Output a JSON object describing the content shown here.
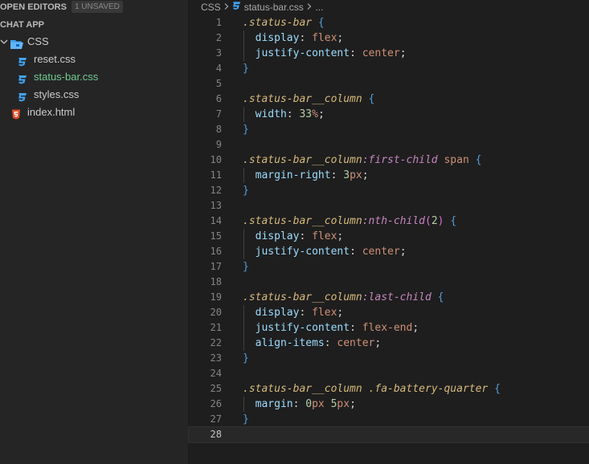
{
  "sidebar": {
    "open_editors": {
      "title": "OPEN EDITORS",
      "badge": "1 UNSAVED"
    },
    "project": {
      "title": "CHAT APP"
    },
    "tree": [
      {
        "label": "CSS",
        "type": "folder",
        "expanded": true,
        "icon": "folder-open-icon"
      },
      {
        "label": "reset.css",
        "type": "css",
        "icon": "css3-icon"
      },
      {
        "label": "status-bar.css",
        "type": "css",
        "icon": "css3-icon",
        "active": true
      },
      {
        "label": "styles.css",
        "type": "css",
        "icon": "css3-icon"
      },
      {
        "label": "index.html",
        "type": "html",
        "icon": "html5-icon"
      }
    ]
  },
  "breadcrumb": {
    "folder": "CSS",
    "file": "status-bar.css",
    "more": "..."
  },
  "editor": {
    "current_line": 28,
    "lines": [
      [
        [
          ".status-bar",
          "sel"
        ],
        [
          " ",
          ""
        ],
        [
          "{",
          "brace"
        ]
      ],
      [
        [
          "  display",
          "prop"
        ],
        [
          ": ",
          "punc"
        ],
        [
          "flex",
          "val"
        ],
        [
          ";",
          "punc"
        ]
      ],
      [
        [
          "  justify-content",
          "prop"
        ],
        [
          ": ",
          "punc"
        ],
        [
          "center",
          "val"
        ],
        [
          ";",
          "punc"
        ]
      ],
      [
        [
          "}",
          "brace"
        ]
      ],
      [],
      [
        [
          ".status-bar__column",
          "sel"
        ],
        [
          " ",
          ""
        ],
        [
          "{",
          "brace"
        ]
      ],
      [
        [
          "  width",
          "prop"
        ],
        [
          ": ",
          "punc"
        ],
        [
          "33",
          "num"
        ],
        [
          "%",
          "unit"
        ],
        [
          ";",
          "punc"
        ]
      ],
      [
        [
          "}",
          "brace"
        ]
      ],
      [],
      [
        [
          ".status-bar__column",
          "sel"
        ],
        [
          ":first-child",
          "pseudo"
        ],
        [
          " ",
          ""
        ],
        [
          "span",
          "val"
        ],
        [
          " ",
          ""
        ],
        [
          "{",
          "brace"
        ]
      ],
      [
        [
          "  margin-right",
          "prop"
        ],
        [
          ": ",
          "punc"
        ],
        [
          "3",
          "num"
        ],
        [
          "px",
          "unit"
        ],
        [
          ";",
          "punc"
        ]
      ],
      [
        [
          "}",
          "brace"
        ]
      ],
      [],
      [
        [
          ".status-bar__column",
          "sel"
        ],
        [
          ":nth-child",
          "pseudo"
        ],
        [
          "(",
          "paren"
        ],
        [
          "2",
          "num"
        ],
        [
          ")",
          "paren"
        ],
        [
          " ",
          ""
        ],
        [
          "{",
          "brace"
        ]
      ],
      [
        [
          "  display",
          "prop"
        ],
        [
          ": ",
          "punc"
        ],
        [
          "flex",
          "val"
        ],
        [
          ";",
          "punc"
        ]
      ],
      [
        [
          "  justify-content",
          "prop"
        ],
        [
          ": ",
          "punc"
        ],
        [
          "center",
          "val"
        ],
        [
          ";",
          "punc"
        ]
      ],
      [
        [
          "}",
          "brace"
        ]
      ],
      [],
      [
        [
          ".status-bar__column",
          "sel"
        ],
        [
          ":last-child",
          "pseudo"
        ],
        [
          " ",
          ""
        ],
        [
          "{",
          "brace"
        ]
      ],
      [
        [
          "  display",
          "prop"
        ],
        [
          ": ",
          "punc"
        ],
        [
          "flex",
          "val"
        ],
        [
          ";",
          "punc"
        ]
      ],
      [
        [
          "  justify-content",
          "prop"
        ],
        [
          ": ",
          "punc"
        ],
        [
          "flex-end",
          "val"
        ],
        [
          ";",
          "punc"
        ]
      ],
      [
        [
          "  align-items",
          "prop"
        ],
        [
          ": ",
          "punc"
        ],
        [
          "center",
          "val"
        ],
        [
          ";",
          "punc"
        ]
      ],
      [
        [
          "}",
          "brace"
        ]
      ],
      [],
      [
        [
          ".status-bar__column",
          "sel"
        ],
        [
          " ",
          ""
        ],
        [
          ".fa-battery-quarter",
          "sel"
        ],
        [
          " ",
          ""
        ],
        [
          "{",
          "brace"
        ]
      ],
      [
        [
          "  margin",
          "prop"
        ],
        [
          ": ",
          "punc"
        ],
        [
          "0",
          "num"
        ],
        [
          "px",
          "unit"
        ],
        [
          " ",
          ""
        ],
        [
          "5",
          "num"
        ],
        [
          "px",
          "unit"
        ],
        [
          ";",
          "punc"
        ]
      ],
      [
        [
          "}",
          "brace"
        ]
      ],
      []
    ]
  },
  "colors": {
    "background": "#1e1e1e",
    "sidebar": "#252526",
    "selector": "#d7ba7d",
    "pseudo": "#c586c0",
    "property": "#9cdcfe",
    "value": "#ce9178",
    "number": "#b5cea8",
    "css_icon": "#42a5f5",
    "html_icon": "#e44d26",
    "active_file": "#73c991"
  }
}
